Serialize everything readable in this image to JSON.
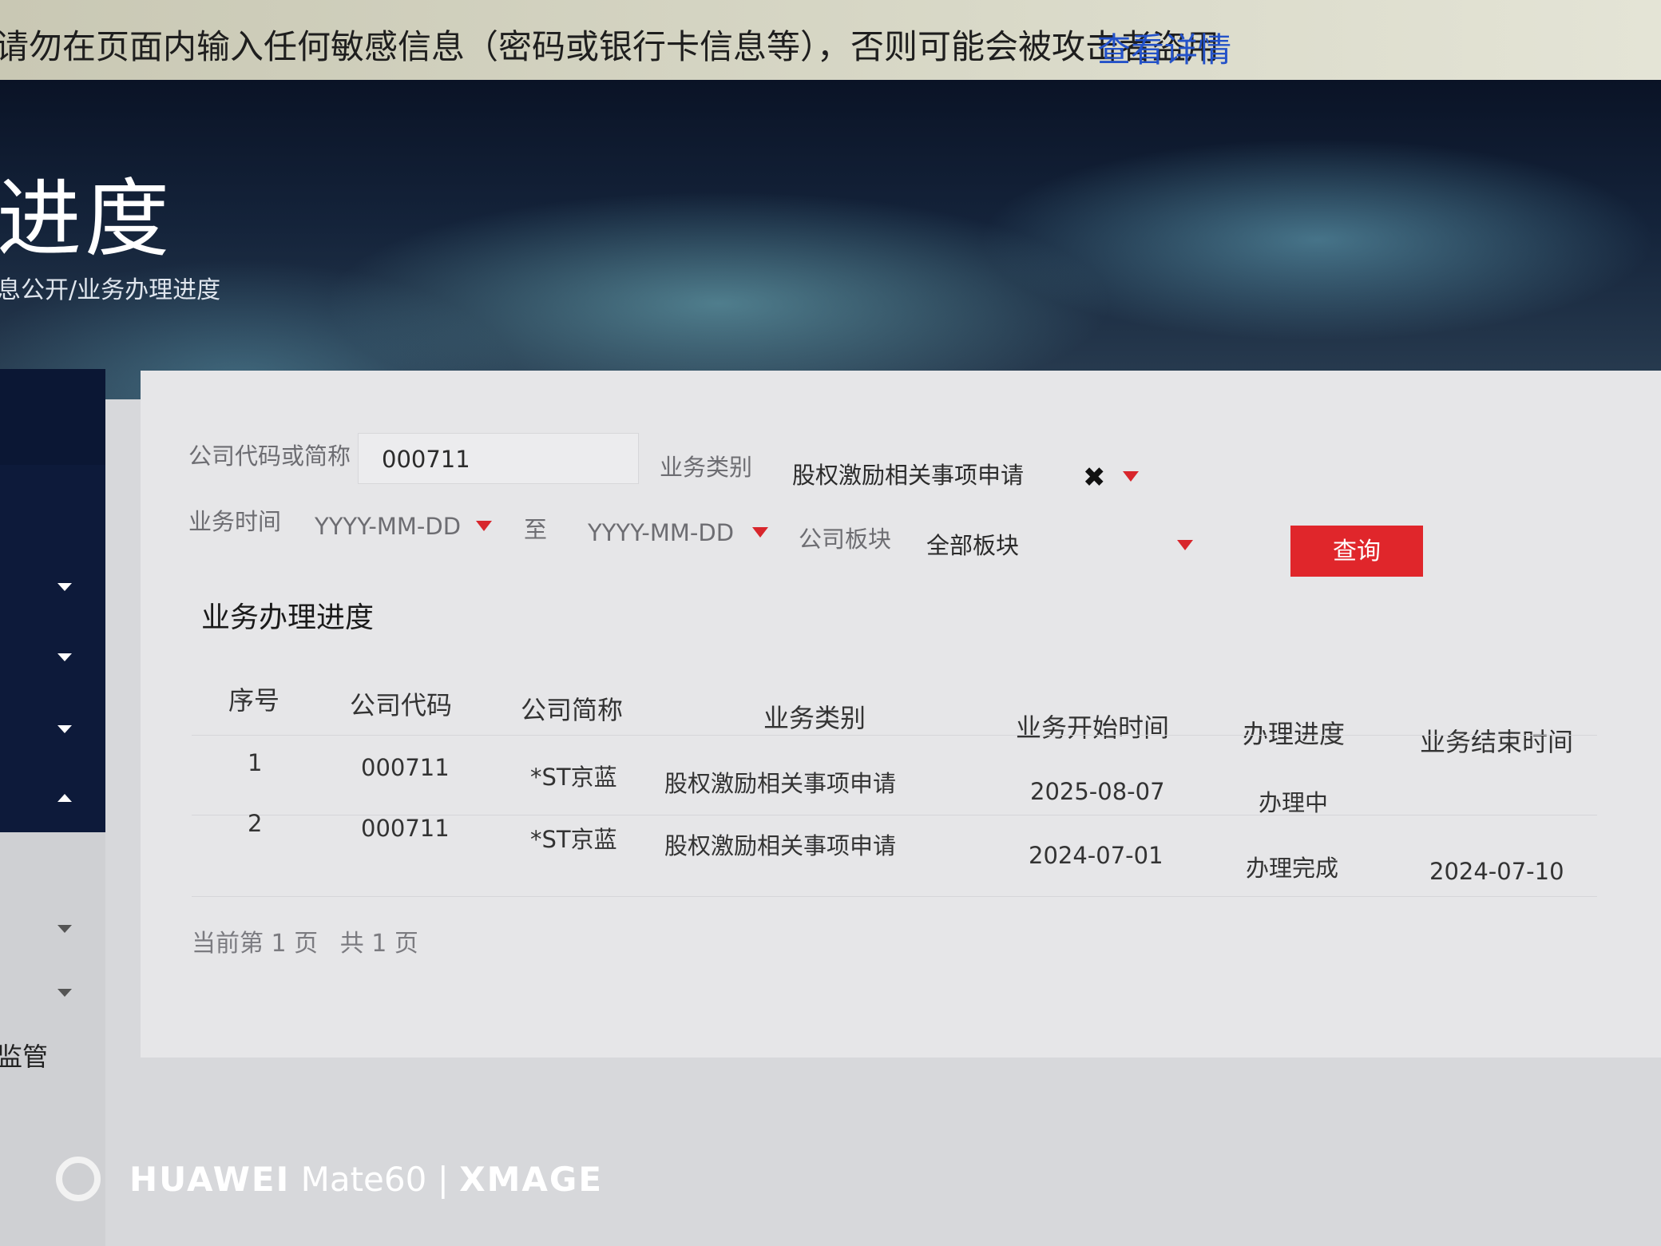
{
  "warning": {
    "message": "请勿在页面内输入任何敏感信息（密码或银行卡信息等），否则可能会被攻击者盗用",
    "link": "查看详情"
  },
  "header": {
    "title": "进度",
    "breadcrumb": "息公开/业务办理进度"
  },
  "sidebar": {
    "bottom_label": "监管"
  },
  "form": {
    "company_label": "公司代码或简称",
    "company_value": "000711",
    "business_type_label": "业务类别",
    "business_type_value": "股权激励相关事项申请",
    "time_label": "业务时间",
    "start_placeholder": "YYYY-MM-DD",
    "to_label": "至",
    "end_placeholder": "YYYY-MM-DD",
    "board_label": "公司板块",
    "board_value": "全部板块",
    "query_button": "查询"
  },
  "results": {
    "title": "业务办理进度",
    "columns": [
      "序号",
      "公司代码",
      "公司简称",
      "业务类别",
      "业务开始时间",
      "办理进度",
      "业务结束时间"
    ],
    "rows": [
      {
        "index": "1",
        "code": "000711",
        "name": "*ST京蓝",
        "type": "股权激励相关事项申请",
        "start": "2025-08-07",
        "status": "办理中",
        "end": ""
      },
      {
        "index": "2",
        "code": "000711",
        "name": "*ST京蓝",
        "type": "股权激励相关事项申请",
        "start": "2024-07-01",
        "status": "办理完成",
        "end": "2024-07-10"
      }
    ]
  },
  "pagination": {
    "current": "当前第 1 页",
    "total": "共 1 页"
  },
  "watermark": {
    "brand": "HUAWEI",
    "model": "Mate60",
    "separator": "|",
    "suffix": "XMAGE"
  },
  "colors": {
    "accent_red": "#e0262b",
    "sidebar_navy": "#0d1a3a",
    "link_blue": "#2452c8"
  }
}
